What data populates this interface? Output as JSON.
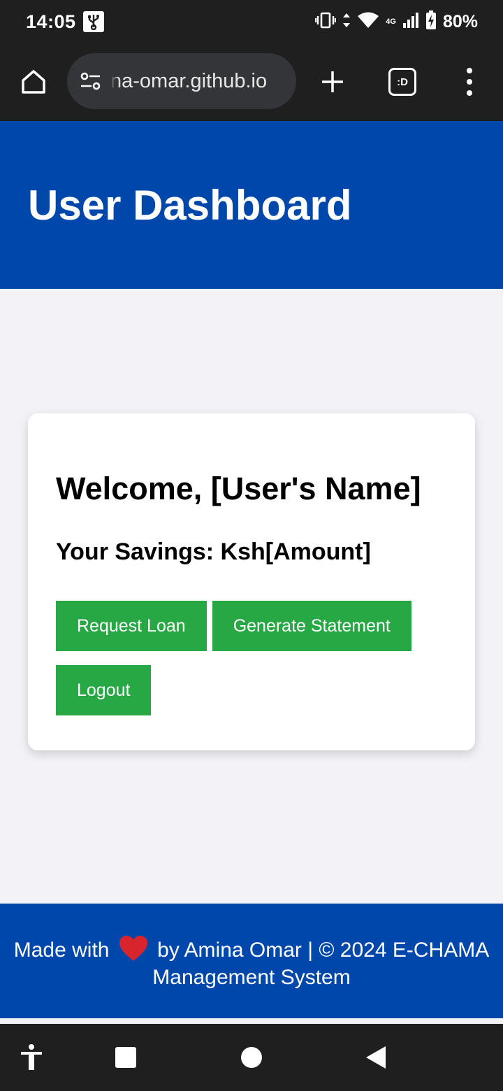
{
  "status_bar": {
    "time": "14:05",
    "network_label": "4G",
    "battery_percent": "80%",
    "icons": [
      "usb-icon",
      "vibrate-icon",
      "data-arrows-icon",
      "wifi-icon",
      "signal-icon",
      "battery-charging-icon"
    ]
  },
  "browser": {
    "url": "na-omar.github.io",
    "tab_count_label": ":D",
    "icons": [
      "home-icon",
      "site-settings-icon",
      "plus-icon",
      "tab-switcher-icon",
      "more-vert-icon"
    ]
  },
  "header": {
    "title": "User Dashboard",
    "background": "#0047ab"
  },
  "card": {
    "welcome": "Welcome, [User's Name]",
    "savings": "Your Savings: Ksh[Amount]",
    "buttons": [
      {
        "label": "Request Loan"
      },
      {
        "label": "Generate Statement"
      },
      {
        "label": "Logout"
      }
    ],
    "button_color": "#28a745"
  },
  "footer": {
    "text_before_heart": "Made with",
    "text_after_heart": "by Amina Omar | © 2024 E-CHAMA",
    "line2": "Management System",
    "heart_icon": "heart-icon"
  },
  "nav_bar": {
    "icons": [
      "accessibility-icon",
      "recents-icon",
      "home-circle-icon",
      "back-icon"
    ]
  }
}
